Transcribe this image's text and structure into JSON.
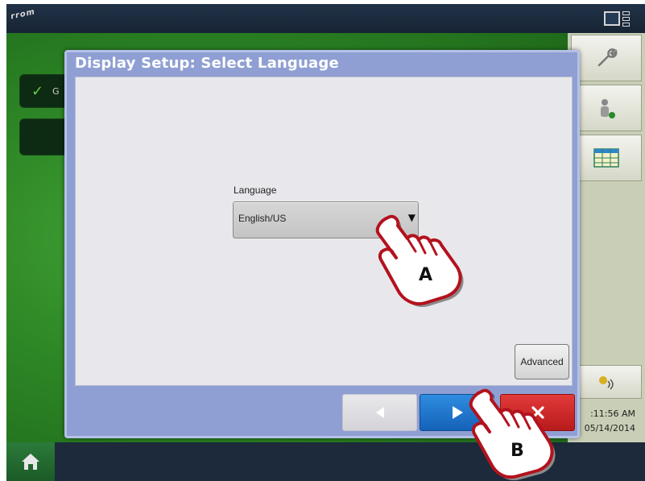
{
  "app": {
    "logo_text": "rrom",
    "background_row_text": "G",
    "clock": {
      "time": ":11:56 AM",
      "date": "05/14/2014"
    }
  },
  "dialog": {
    "title": "Display Setup: Select Language",
    "language_label": "Language",
    "language_value": "English/US",
    "advanced_label": "Advanced"
  },
  "callouts": {
    "a": "A",
    "b": "B"
  },
  "colors": {
    "dialog_frame": "#8f9fd3",
    "next_button": "#1f75cf",
    "cancel_button": "#d02828",
    "green_area": "#3a9a30"
  },
  "icons": [
    "wrench-icon",
    "operator-icon",
    "grid-icon",
    "status-icon",
    "home-icon",
    "layout-icon",
    "dropdown-arrow-icon",
    "back-arrow-icon",
    "next-arrow-icon",
    "close-icon",
    "check-icon"
  ]
}
